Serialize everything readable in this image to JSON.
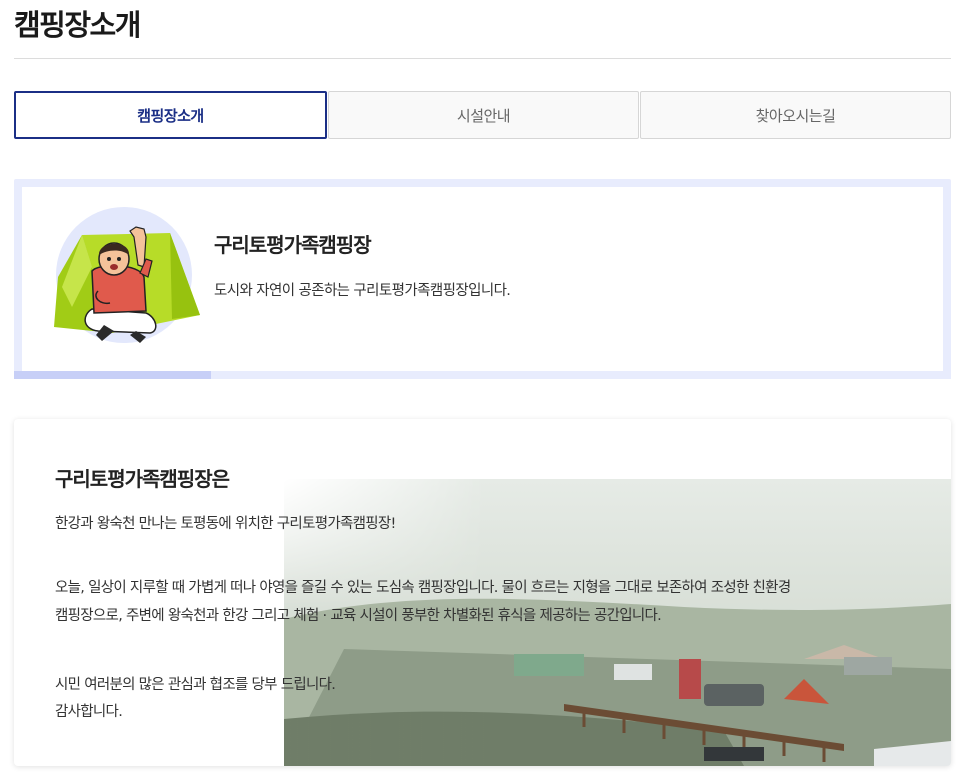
{
  "page": {
    "title": "캠핑장소개"
  },
  "tabs": [
    {
      "label": "캠핑장소개",
      "active": true
    },
    {
      "label": "시설안내",
      "active": false
    },
    {
      "label": "찾아오시는길",
      "active": false
    }
  ],
  "intro": {
    "name": "구리토평가족캠핑장",
    "description": "도시와 자연이 공존하는 구리토평가족캠핑장입니다.",
    "progress": 0.21
  },
  "detail": {
    "heading": "구리토평가족캠핑장은",
    "p1": "한강과 왕숙천 만나는 토평동에 위치한 구리토평가족캠핑장!",
    "p2_line1": "오늘, 일상이 지루할 때 가볍게 떠나 야영을 즐길 수 있는 도심속 캠핑장입니다. 물이 흐르는 지형을 그대로 보존하여 조성한 친환경",
    "p2_line2": "캠핑장으로, 주변에 왕숙천과 한강 그리고 체험 · 교육 시설이 풍부한 차별화된 휴식을 제공하는 공간입니다.",
    "p3_line1": "시민 여러분의 많은 관심과 협조를 당부 드립니다.",
    "p3_line2": "감사합니다."
  },
  "colors": {
    "accent": "#1b2f86",
    "intro_border": "#e8ecfd",
    "progress_fill": "#c7cff7",
    "tent_green": "#a8d21a"
  }
}
